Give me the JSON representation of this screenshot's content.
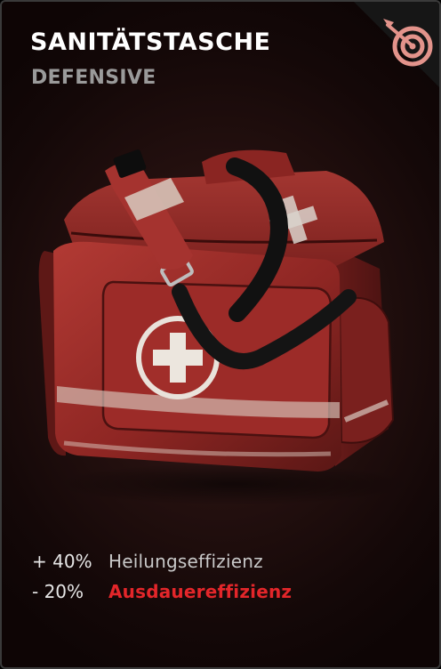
{
  "item": {
    "title": "SANITÄTSTASCHE",
    "category": "DEFENSIVE",
    "category_icon": "target-icon",
    "image_icon": "medic-bag-icon"
  },
  "stats": [
    {
      "value": "+ 40%",
      "label": "Heilungseffizienz",
      "positive": true
    },
    {
      "value": "- 20%",
      "label": "Ausdauereffizienz",
      "positive": false
    }
  ],
  "colors": {
    "corner_badge": "#e3938b",
    "negative_stat": "#e3262a",
    "bag_red": "#9b2a27"
  }
}
